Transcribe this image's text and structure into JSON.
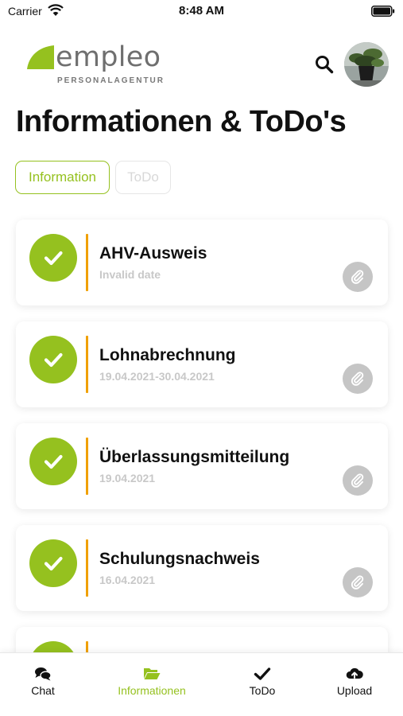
{
  "status_bar": {
    "carrier": "Carrier",
    "time": "8:48 AM"
  },
  "header": {
    "logo_text": "empleo",
    "logo_subtext": "PERSONALAGENTUR",
    "search_icon": "search-icon",
    "avatar_icon": "avatar"
  },
  "page": {
    "title": "Informationen & ToDo's"
  },
  "segments": [
    {
      "label": "Information",
      "active": true
    },
    {
      "label": "ToDo",
      "active": false
    }
  ],
  "cards": [
    {
      "title": "AHV-Ausweis",
      "date": "Invalid date"
    },
    {
      "title": "Lohnabrechnung",
      "date": "19.04.2021-30.04.2021"
    },
    {
      "title": "Überlassungsmitteilung",
      "date": "19.04.2021"
    },
    {
      "title": "Schulungsnachweis",
      "date": "16.04.2021"
    }
  ],
  "tabs": [
    {
      "label": "Chat",
      "icon": "chat-icon",
      "active": false
    },
    {
      "label": "Informationen",
      "icon": "folder-open-icon",
      "active": true
    },
    {
      "label": "ToDo",
      "icon": "check-icon",
      "active": false
    },
    {
      "label": "Upload",
      "icon": "cloud-upload-icon",
      "active": false
    }
  ],
  "colors": {
    "accent": "#95c11f",
    "bar": "#f0a000",
    "muted": "#c8c8c8"
  }
}
